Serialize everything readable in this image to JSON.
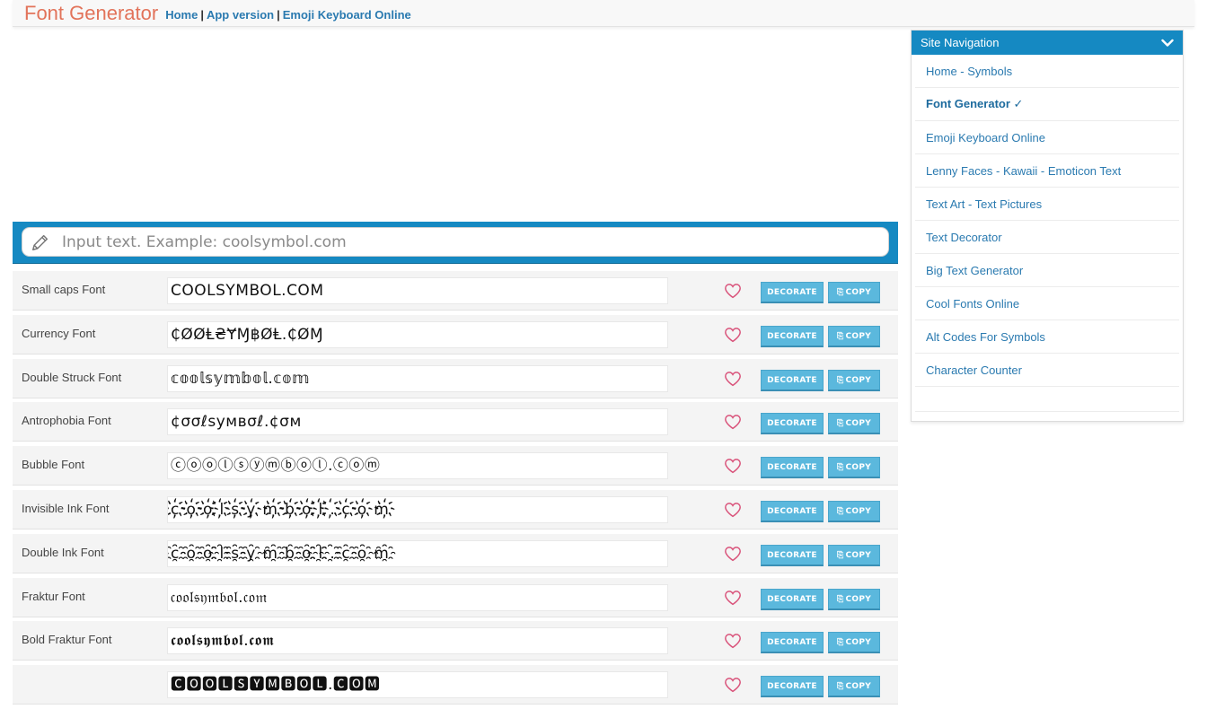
{
  "header": {
    "brand": "Font Generator",
    "links": [
      {
        "label": "Home"
      },
      {
        "label": "App version"
      },
      {
        "label": "Emoji Keyboard Online"
      }
    ],
    "separator": "|"
  },
  "search": {
    "placeholder": "Input text. Example: coolsymbol.com",
    "icon": "pencil-icon"
  },
  "rows": [
    {
      "label": "Small caps Font",
      "sample": "COOLSYMBOL.COM"
    },
    {
      "label": "Currency Font",
      "sample": "₵ØØⱠ₴ɎⱮ฿ØⱠ.₵ØⱮ"
    },
    {
      "label": "Double Struck Font",
      "sample": "𝕔𝕠𝕠𝕝𝕤𝕪𝕞𝕓𝕠𝕝.𝕔𝕠𝕞"
    },
    {
      "label": "Antrophobia Font",
      "sample": "¢σσℓѕумвσℓ.¢σм"
    },
    {
      "label": "Bubble Font",
      "sample": "ⓒⓞⓞⓛⓢⓨⓜⓑⓞⓛ.ⓒⓞⓜ"
    },
    {
      "label": "Invisible Ink Font",
      "sample": "c҉o҉o҉l҉s҉y҉m҉b҉o҉l҉.҉c҉o҉m҉"
    },
    {
      "label": "Double Ink Font",
      "sample": "c҈o҈o҈l҈s҈y҈m҈b҈o҈l҈.҈c҈o҈m҈"
    },
    {
      "label": "Fraktur Font",
      "sample": "𝔠𝔬𝔬𝔩𝔰𝔶𝔪𝔟𝔬𝔩.𝔠𝔬𝔪"
    },
    {
      "label": "Bold Fraktur Font",
      "sample": "𝖈𝖔𝖔𝖑𝖘𝖞𝖒𝖇𝖔𝖑.𝖈𝖔𝖒"
    },
    {
      "label": "",
      "sample": "🅲🅾🅾🅻🆂🆈🅼🅱🅾🅻.🅲🅾🅼"
    }
  ],
  "buttons": {
    "decorate": "DECORATE",
    "copy": "COPY",
    "copy_glyph": "⎘"
  },
  "sidebar": {
    "title": "Site Navigation",
    "items": [
      {
        "label": "Home - Symbols",
        "active": false
      },
      {
        "label": "Font Generator ✓",
        "active": true
      },
      {
        "label": "Emoji Keyboard Online",
        "active": false
      },
      {
        "label": "Lenny Faces - Kawaii - Emoticon Text",
        "active": false
      },
      {
        "label": "Text Art - Text Pictures",
        "active": false
      },
      {
        "label": "Text Decorator",
        "active": false
      },
      {
        "label": "Big Text Generator",
        "active": false
      },
      {
        "label": "Cool Fonts Online",
        "active": false
      },
      {
        "label": "Alt Codes For Symbols",
        "active": false
      },
      {
        "label": "Character Counter",
        "active": false
      }
    ]
  },
  "colors": {
    "brand": "#e2735a",
    "accent": "#1589c2",
    "link": "#2a7ab0",
    "button": "#5bb8dd",
    "heart": "#d9527a"
  }
}
